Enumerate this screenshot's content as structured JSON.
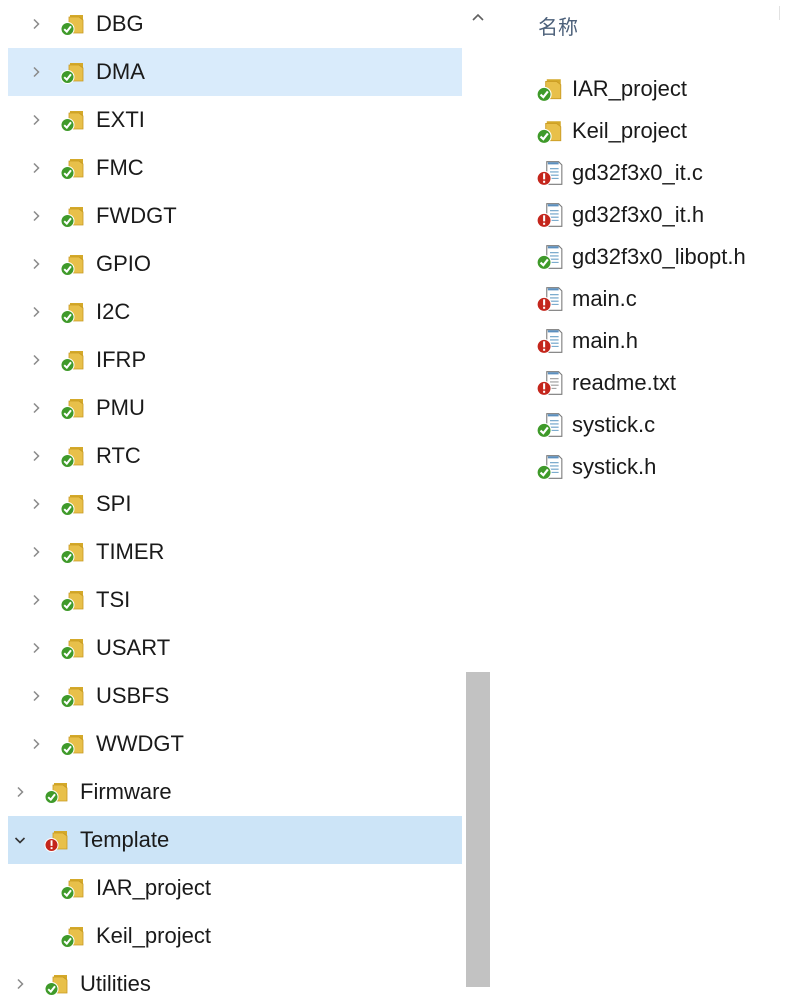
{
  "nav": {
    "children": [
      {
        "label": "DBG",
        "icon": "folder-ok-icon"
      },
      {
        "label": "DMA",
        "icon": "folder-ok-icon"
      },
      {
        "label": "EXTI",
        "icon": "folder-ok-icon"
      },
      {
        "label": "FMC",
        "icon": "folder-ok-icon"
      },
      {
        "label": "FWDGT",
        "icon": "folder-ok-icon"
      },
      {
        "label": "GPIO",
        "icon": "folder-ok-icon"
      },
      {
        "label": "I2C",
        "icon": "folder-ok-icon"
      },
      {
        "label": "IFRP",
        "icon": "folder-ok-icon"
      },
      {
        "label": "PMU",
        "icon": "folder-ok-icon"
      },
      {
        "label": "RTC",
        "icon": "folder-ok-icon"
      },
      {
        "label": "SPI",
        "icon": "folder-ok-icon"
      },
      {
        "label": "TIMER",
        "icon": "folder-ok-icon"
      },
      {
        "label": "TSI",
        "icon": "folder-ok-icon"
      },
      {
        "label": "USART",
        "icon": "folder-ok-icon"
      },
      {
        "label": "USBFS",
        "icon": "folder-ok-icon"
      },
      {
        "label": "WWDGT",
        "icon": "folder-ok-icon"
      }
    ],
    "firmware": {
      "label": "Firmware",
      "icon": "folder-ok-icon"
    },
    "template": {
      "label": "Template",
      "icon": "folder-error-icon"
    },
    "template_children": [
      {
        "label": "IAR_project",
        "icon": "folder-ok-icon"
      },
      {
        "label": "Keil_project",
        "icon": "folder-ok-icon"
      }
    ],
    "utilities": {
      "label": "Utilities",
      "icon": "folder-ok-icon"
    },
    "hovered_item": "DMA",
    "selected_item": "Template"
  },
  "scrollbar": {
    "position_fraction": 0.97
  },
  "files": {
    "column_name": "名称",
    "items": [
      {
        "label": "IAR_project",
        "icon": "folder-ok-icon"
      },
      {
        "label": "Keil_project",
        "icon": "folder-ok-icon"
      },
      {
        "label": "gd32f3x0_it.c",
        "icon": "file-error-icon"
      },
      {
        "label": "gd32f3x0_it.h",
        "icon": "file-error-icon"
      },
      {
        "label": "gd32f3x0_libopt.h",
        "icon": "file-ok-icon"
      },
      {
        "label": "main.c",
        "icon": "file-error-icon"
      },
      {
        "label": "main.h",
        "icon": "file-error-icon"
      },
      {
        "label": "readme.txt",
        "icon": "textfile-error-icon"
      },
      {
        "label": "systick.c",
        "icon": "file-ok-icon"
      },
      {
        "label": "systick.h",
        "icon": "file-ok-icon"
      }
    ]
  },
  "colors": {
    "hover_bg": "#d9ebfb",
    "selected_bg": "#cce4f7",
    "ok_badge": "#3f9a2a",
    "error_badge": "#c4261c",
    "folder": "#e8c04a"
  }
}
